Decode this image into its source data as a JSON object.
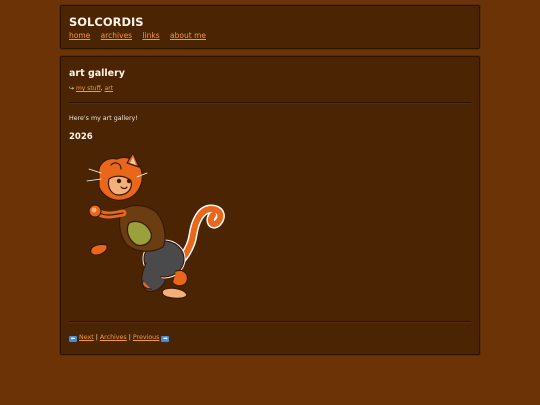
{
  "site": {
    "title": "SOLCORDIS",
    "nav": [
      "home",
      "archives",
      "links",
      "about me"
    ]
  },
  "post": {
    "title": "art gallery",
    "tag_arrow": "↪",
    "tags": [
      "my stuff",
      "art"
    ],
    "tag_separator": ",",
    "intro": "Here's my art gallery!",
    "year_heading": "2026",
    "artwork_subject": "orange cat character illustration"
  },
  "pager": {
    "prev_arrow": "⬅",
    "next_label": "Next",
    "separator": "|",
    "archives_label": "Archives",
    "previous_label": "Previous",
    "next_arrow": "➡"
  },
  "colors": {
    "background": "#6b3306",
    "panel": "#4b2404",
    "link": "#f39a3a",
    "text": "#f3e6d6"
  }
}
